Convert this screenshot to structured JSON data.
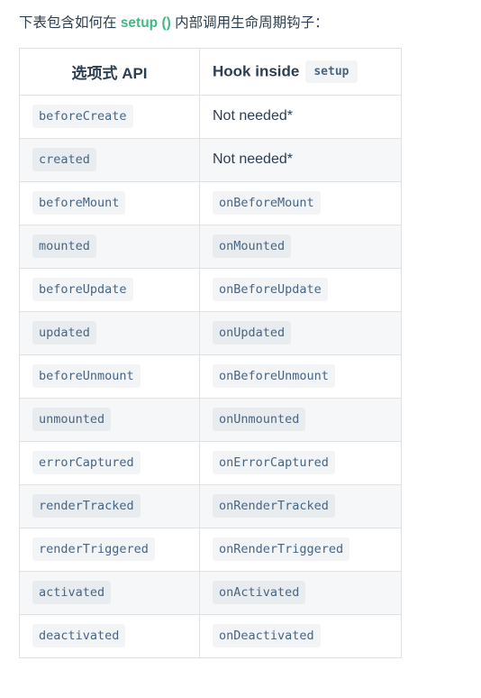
{
  "intro": {
    "before": "下表包含如何在 ",
    "code": "setup ()",
    "after": " 内部调用生命周期钩子："
  },
  "colors": {
    "accent_green": "#42b883",
    "text": "#2c3e50",
    "code_text": "#476582",
    "code_bg_odd": "#f3f4f5",
    "code_bg_even": "#e9ecef",
    "row_stripe": "#f6f7f9",
    "border": "#dfe2e5"
  },
  "table": {
    "headers": {
      "api": "选项式 API",
      "hook_label": "Hook inside",
      "hook_code": "setup"
    },
    "rows": [
      {
        "api": "beforeCreate",
        "api_is_code": true,
        "hook": "Not needed*",
        "hook_is_code": false
      },
      {
        "api": "created",
        "api_is_code": true,
        "hook": "Not needed*",
        "hook_is_code": false
      },
      {
        "api": "beforeMount",
        "api_is_code": true,
        "hook": "onBeforeMount",
        "hook_is_code": true
      },
      {
        "api": "mounted",
        "api_is_code": true,
        "hook": "onMounted",
        "hook_is_code": true
      },
      {
        "api": "beforeUpdate",
        "api_is_code": true,
        "hook": "onBeforeUpdate",
        "hook_is_code": true
      },
      {
        "api": "updated",
        "api_is_code": true,
        "hook": "onUpdated",
        "hook_is_code": true
      },
      {
        "api": "beforeUnmount",
        "api_is_code": true,
        "hook": "onBeforeUnmount",
        "hook_is_code": true
      },
      {
        "api": "unmounted",
        "api_is_code": true,
        "hook": "onUnmounted",
        "hook_is_code": true
      },
      {
        "api": "errorCaptured",
        "api_is_code": true,
        "hook": "onErrorCaptured",
        "hook_is_code": true
      },
      {
        "api": "renderTracked",
        "api_is_code": true,
        "hook": "onRenderTracked",
        "hook_is_code": true
      },
      {
        "api": "renderTriggered",
        "api_is_code": true,
        "hook": "onRenderTriggered",
        "hook_is_code": true
      },
      {
        "api": "activated",
        "api_is_code": true,
        "hook": "onActivated",
        "hook_is_code": true
      },
      {
        "api": "deactivated",
        "api_is_code": true,
        "hook": "onDeactivated",
        "hook_is_code": true
      }
    ]
  }
}
